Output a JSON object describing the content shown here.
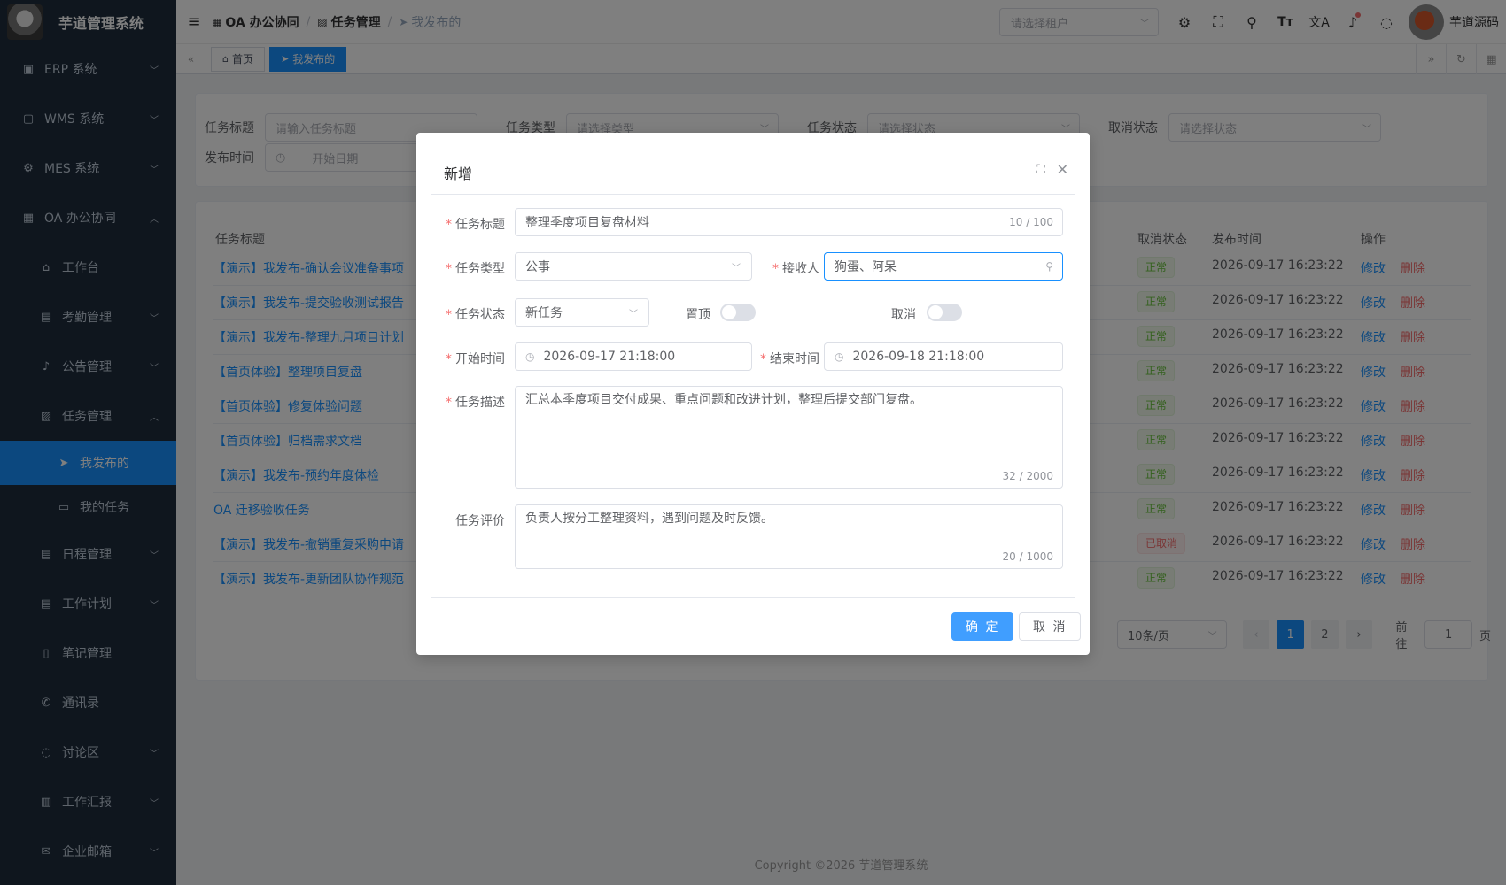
{
  "app": {
    "title": "芋道管理系统"
  },
  "sidebar": {
    "items": [
      {
        "label": "ERP 系统",
        "icon": "erp-icon",
        "glyph": "▣",
        "expandable": true,
        "expanded": false
      },
      {
        "label": "WMS 系统",
        "icon": "box-icon",
        "glyph": "▢",
        "expandable": true,
        "expanded": false
      },
      {
        "label": "MES 系统",
        "icon": "gear-icon",
        "glyph": "⚙",
        "expandable": true,
        "expanded": false
      },
      {
        "label": "OA 办公协同",
        "icon": "office-icon",
        "glyph": "▦",
        "expandable": true,
        "expanded": true
      }
    ],
    "oa_children": [
      {
        "label": "工作台",
        "icon": "home-icon",
        "glyph": "⌂",
        "expandable": false
      },
      {
        "label": "考勤管理",
        "icon": "calendar-icon",
        "glyph": "▤",
        "expandable": true
      },
      {
        "label": "公告管理",
        "icon": "bell-icon",
        "glyph": "♪",
        "expandable": true
      },
      {
        "label": "任务管理",
        "icon": "clipboard-icon",
        "glyph": "▨",
        "expandable": true,
        "expanded": true
      }
    ],
    "task_children": [
      {
        "label": "我发布的",
        "icon": "send-icon",
        "glyph": "➤",
        "active": true
      },
      {
        "label": "我的任务",
        "icon": "document-icon",
        "glyph": "▭",
        "active": false
      }
    ],
    "oa_children_after": [
      {
        "label": "日程管理",
        "icon": "calendar-icon",
        "glyph": "▤",
        "expandable": true
      },
      {
        "label": "工作计划",
        "icon": "calendar-icon",
        "glyph": "▤",
        "expandable": true
      },
      {
        "label": "笔记管理",
        "icon": "note-icon",
        "glyph": "▯",
        "expandable": false
      },
      {
        "label": "通讯录",
        "icon": "phone-icon",
        "glyph": "✆",
        "expandable": false
      },
      {
        "label": "讨论区",
        "icon": "chat-icon",
        "glyph": "◌",
        "expandable": true
      },
      {
        "label": "工作汇报",
        "icon": "report-icon",
        "glyph": "▥",
        "expandable": true
      },
      {
        "label": "企业邮箱",
        "icon": "mail-icon",
        "glyph": "✉",
        "expandable": true
      }
    ]
  },
  "header": {
    "breadcrumb": [
      {
        "label": "OA 办公协同",
        "icon": "building-icon"
      },
      {
        "label": "任务管理",
        "icon": "clipboard-icon"
      },
      {
        "label": "我发布的",
        "icon": "send-icon"
      }
    ],
    "tenant_placeholder": "请选择租户",
    "user_name": "芋道源码"
  },
  "tags_view": {
    "tags": [
      {
        "label": "首页",
        "icon": "home-icon",
        "active": false
      },
      {
        "label": "我发布的",
        "icon": "send-icon",
        "active": true
      }
    ]
  },
  "search_form": {
    "title_label": "任务标题",
    "title_placeholder": "请输入任务标题",
    "type_label": "任务类型",
    "type_placeholder": "请选择类型",
    "status_label": "任务状态",
    "status_placeholder": "请选择状态",
    "cancel_label": "取消状态",
    "cancel_placeholder": "请选择状态",
    "publish_label": "发布时间",
    "start_placeholder": "开始日期"
  },
  "table": {
    "columns": {
      "title": "任务标题",
      "cancel_status": "取消状态",
      "publish_time": "发布时间",
      "actions": "操作"
    },
    "rows": [
      {
        "title": "【演示】我发布-确认会议准备事项",
        "cancel_status": "正常",
        "time": "2026-09-17 16:23:22"
      },
      {
        "title": "【演示】我发布-提交验收测试报告",
        "cancel_status": "正常",
        "time": "2026-09-17 16:23:22"
      },
      {
        "title": "【演示】我发布-整理九月项目计划",
        "cancel_status": "正常",
        "time": "2026-09-17 16:23:22"
      },
      {
        "title": "【首页体验】整理项目复盘",
        "cancel_status": "正常",
        "time": "2026-09-17 16:23:22"
      },
      {
        "title": "【首页体验】修复体验问题",
        "cancel_status": "正常",
        "time": "2026-09-17 16:23:22"
      },
      {
        "title": "【首页体验】归档需求文档",
        "cancel_status": "正常",
        "time": "2026-09-17 16:23:22"
      },
      {
        "title": "【演示】我发布-预约年度体检",
        "cancel_status": "正常",
        "time": "2026-09-17 16:23:22"
      },
      {
        "title": "OA 迁移验收任务",
        "cancel_status": "正常",
        "time": "2026-09-17 16:23:22"
      },
      {
        "title": "【演示】我发布-撤销重复采购申请",
        "cancel_status": "已取消",
        "time": "2026-09-17 16:23:22"
      },
      {
        "title": "【演示】我发布-更新团队协作规范",
        "cancel_status": "正常",
        "time": "2026-09-17 16:23:22"
      }
    ],
    "edit_label": "修改",
    "delete_label": "删除"
  },
  "pagination": {
    "page_size": "10条/页",
    "pages": [
      "1",
      "2"
    ],
    "current": "1",
    "goto_label": "前往",
    "goto_value": "1",
    "page_suffix": "页"
  },
  "footer": {
    "copyright": "Copyright ©2026 芋道管理系统"
  },
  "dialog": {
    "title": "新增",
    "fields": {
      "task_title": {
        "label": "任务标题",
        "value": "整理季度项目复盘材料",
        "count": "10 / 100"
      },
      "task_type": {
        "label": "任务类型",
        "value": "公事"
      },
      "receiver": {
        "label": "接收人",
        "value": "狗蛋、阿呆"
      },
      "task_status": {
        "label": "任务状态",
        "value": "新任务"
      },
      "pin": {
        "label": "置顶",
        "on": false
      },
      "cancel": {
        "label": "取消",
        "on": false
      },
      "start_time": {
        "label": "开始时间",
        "value": "2026-09-17 21:18:00"
      },
      "end_time": {
        "label": "结束时间",
        "value": "2026-09-18 21:18:00"
      },
      "description": {
        "label": "任务描述",
        "value": "汇总本季度项目交付成果、重点问题和改进计划，整理后提交部门复盘。",
        "count": "32 / 2000"
      },
      "evaluation": {
        "label": "任务评价",
        "value": "负责人按分工整理资料，遇到问题及时反馈。",
        "count": "20 / 1000"
      }
    },
    "confirm_label": "确 定",
    "cancel_label": "取 消"
  },
  "colors": {
    "sidebar_bg": "#1f2d3d",
    "primary": "#1890ff",
    "danger": "#f56c6c",
    "success": "#67c23a"
  }
}
